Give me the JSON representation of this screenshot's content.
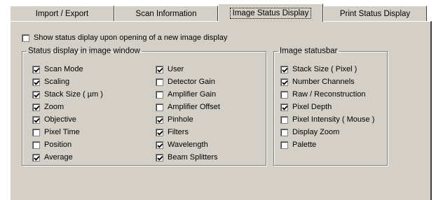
{
  "tabs": [
    {
      "label": "Import / Export",
      "active": false
    },
    {
      "label": "Scan Information",
      "active": false
    },
    {
      "label": "Image Status Display",
      "active": true
    },
    {
      "label": "Print Status Display",
      "active": false
    }
  ],
  "show_status": {
    "label": "Show status diplay upon opening of a new image display",
    "checked": false
  },
  "status_group": {
    "title": "Status display in image window",
    "col1": [
      {
        "label": "Scan Mode",
        "checked": true
      },
      {
        "label": "Scaling",
        "checked": true
      },
      {
        "label": "Stack Size ( µm )",
        "checked": true
      },
      {
        "label": "Zoom",
        "checked": true
      },
      {
        "label": "Objective",
        "checked": true
      },
      {
        "label": "Pixel Time",
        "checked": false
      },
      {
        "label": "Position",
        "checked": false
      },
      {
        "label": "Average",
        "checked": true
      }
    ],
    "col2": [
      {
        "label": "User",
        "checked": true
      },
      {
        "label": "Detector Gain",
        "checked": false
      },
      {
        "label": "Amplifier Gain",
        "checked": false
      },
      {
        "label": "Amplifier Offset",
        "checked": false
      },
      {
        "label": "Pinhole",
        "checked": true
      },
      {
        "label": "Filters",
        "checked": true
      },
      {
        "label": "Wavelength",
        "checked": true
      },
      {
        "label": "Beam Splitters",
        "checked": true
      }
    ]
  },
  "statusbar_group": {
    "title": "Image statusbar",
    "items": [
      {
        "label": "Stack Size ( Pixel )",
        "checked": true
      },
      {
        "label": "Number Channels",
        "checked": true
      },
      {
        "label": "Raw / Reconstruction",
        "checked": false
      },
      {
        "label": "Pixel Depth",
        "checked": true
      },
      {
        "label": "Pixel Intensity ( Mouse )",
        "checked": false
      },
      {
        "label": "Display Zoom",
        "checked": false
      },
      {
        "label": "Palette",
        "checked": false
      }
    ]
  }
}
